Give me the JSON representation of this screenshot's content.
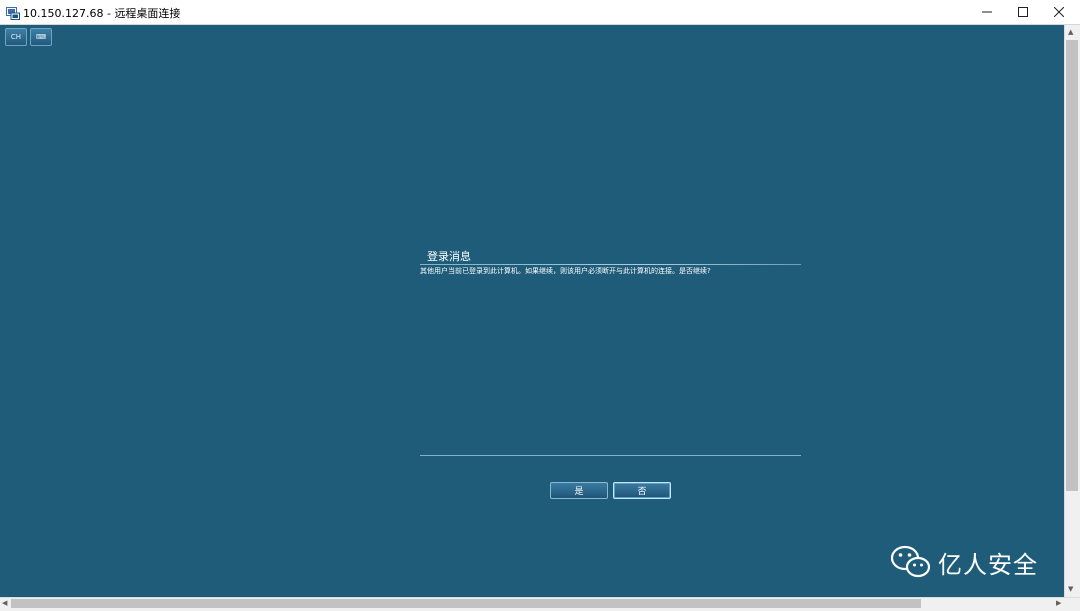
{
  "window": {
    "title": "10.150.127.68 - 远程桌面连接",
    "controls": {
      "minimize": "—",
      "maximize": "☐",
      "close": "✕"
    }
  },
  "toolbar": {
    "lang_label": "CH",
    "keyboard_label": "⌨"
  },
  "dialog": {
    "title": "登录消息",
    "message": "其他用户当前已登录到此计算机。如果继续，则该用户必须断开与此计算机的连接。是否继续?",
    "yes_label": "是",
    "no_label": "否"
  },
  "scrollbars": {
    "up_arrow": "▲",
    "down_arrow": "▼",
    "left_arrow": "◀",
    "right_arrow": "▶"
  },
  "watermark": {
    "text": "亿人安全",
    "icon": "wechat-icon"
  },
  "colors": {
    "desktop_bg": "#1f5c7a",
    "titlebar_bg": "#ffffff",
    "button_border": "#8bb8d2"
  }
}
